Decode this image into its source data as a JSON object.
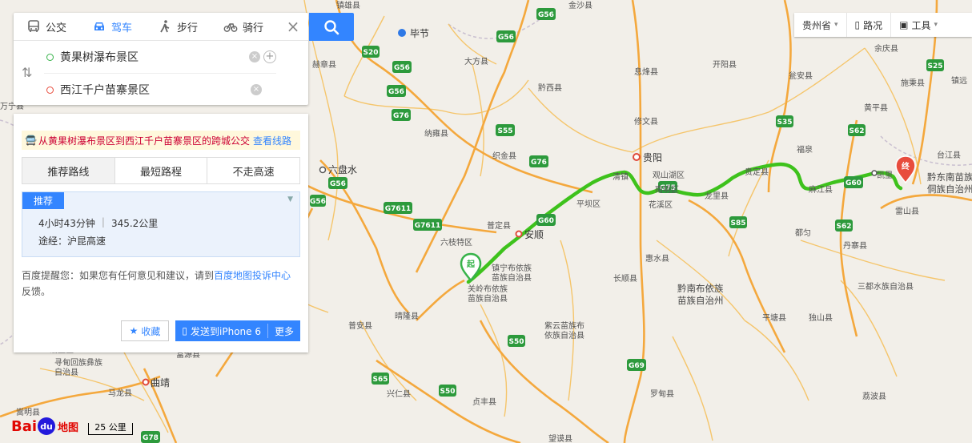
{
  "modes": {
    "bus": "公交",
    "drive": "驾车",
    "walk": "步行",
    "bike": "骑行"
  },
  "route": {
    "start": "黄果树瀑布景区",
    "end": "西江千户苗寨景区"
  },
  "transit_tip": {
    "text": "从黄果树瀑布景区到西江千户苗寨景区的跨城公交",
    "link": "查看线路"
  },
  "plan_tabs": [
    "推荐路线",
    "最短路程",
    "不走高速"
  ],
  "plan": {
    "badge": "推荐",
    "duration": "4小时43分钟",
    "distance": "345.2公里",
    "via": "途经：沪昆高速"
  },
  "feedback": {
    "prefix": "百度提醒您：如果您有任何意见和建议，请到",
    "link": "百度地图投诉中心",
    "suffix": "反馈。"
  },
  "actions": {
    "favorite": "收藏",
    "send": "发送到iPhone 6",
    "more": "更多"
  },
  "toolbar": {
    "province": "贵州省",
    "traffic": "路况",
    "tools": "工具"
  },
  "scale": "25 公里",
  "logo": {
    "bai": "Bai",
    "du": "du",
    "ditu": "地图"
  },
  "map": {
    "markers": {
      "start": "起",
      "end": "终"
    },
    "cities": [
      {
        "id": "bijie",
        "name": "毕节"
      },
      {
        "id": "guiyang",
        "name": "贵阳"
      },
      {
        "id": "anshun",
        "name": "安顺"
      },
      {
        "id": "liupanshui",
        "name": "六盘水"
      },
      {
        "id": "qujing",
        "name": "曲靖"
      },
      {
        "id": "kaili",
        "name": "凯里"
      }
    ],
    "places": [
      "镇雄县",
      "金沙县",
      "赫章县",
      "大方县",
      "黔西县",
      "息烽县",
      "开阳县",
      "余庆县",
      "施秉县",
      "镇远县",
      "纳雍县",
      "修文县",
      "瓮安县",
      "黄平县",
      "台江县",
      "织金县",
      "福泉",
      "清镇",
      "观山湖区",
      "南明区",
      "贵定县",
      "龙里县",
      "麻江县",
      "雷山县",
      "平坝区",
      "花溪区",
      "普定县",
      "六枝特区",
      "都匀",
      "丹寨县",
      "三都水族自治县",
      "惠水县",
      "长顺县",
      "平塘县",
      "独山县",
      "晴隆县",
      "普安县",
      "贞丰县",
      "兴仁县",
      "罗甸县",
      "荔波县",
      "马龙县",
      "富源县",
      "嵩明县",
      "沾益区",
      "万宁县"
    ],
    "regions": [
      "镇宁布依族苗族自治县",
      "关岭布依族苗族自治县",
      "黔南布依族苗族自治州",
      "黔东南苗族侗族自治州",
      "紫云苗族布依族苗族自治县",
      "寻甸回族彝族自治县"
    ],
    "highways": [
      "G56",
      "S20",
      "G76",
      "S55",
      "G7611",
      "G60",
      "G75",
      "S35",
      "S85",
      "S62",
      "S25",
      "G62",
      "G69",
      "S50",
      "S65",
      "G78",
      "G60"
    ]
  }
}
